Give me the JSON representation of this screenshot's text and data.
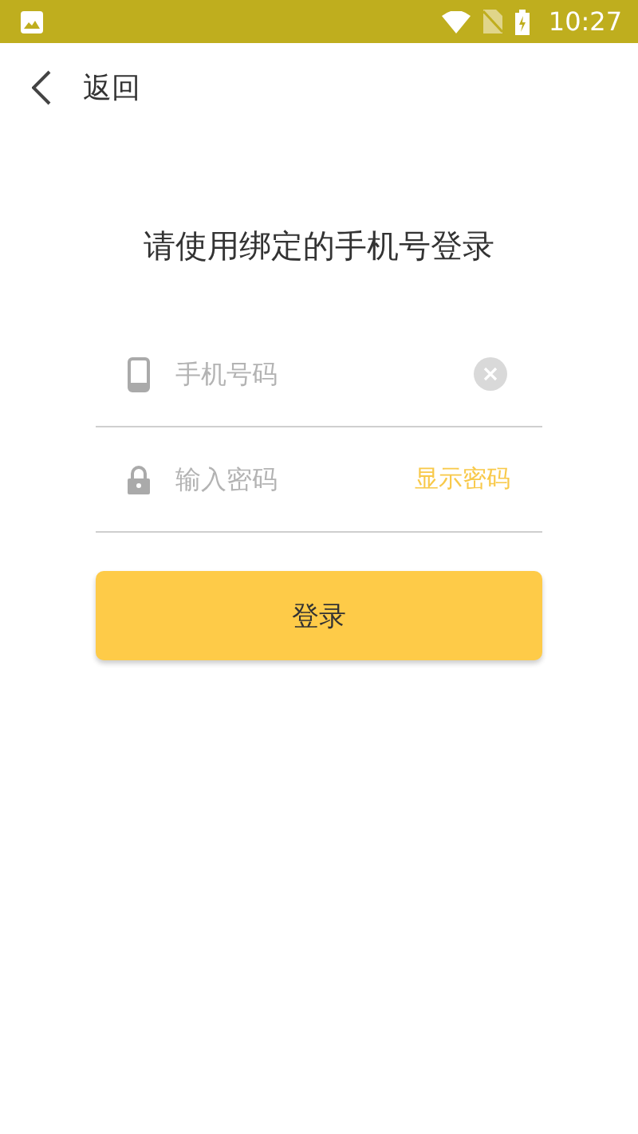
{
  "status_bar": {
    "time": "10:27"
  },
  "header": {
    "back_label": "返回"
  },
  "title": "请使用绑定的手机号登录",
  "phone_field": {
    "placeholder": "手机号码"
  },
  "password_field": {
    "placeholder": "输入密码",
    "toggle_label": "显示密码"
  },
  "login_button": "登录"
}
